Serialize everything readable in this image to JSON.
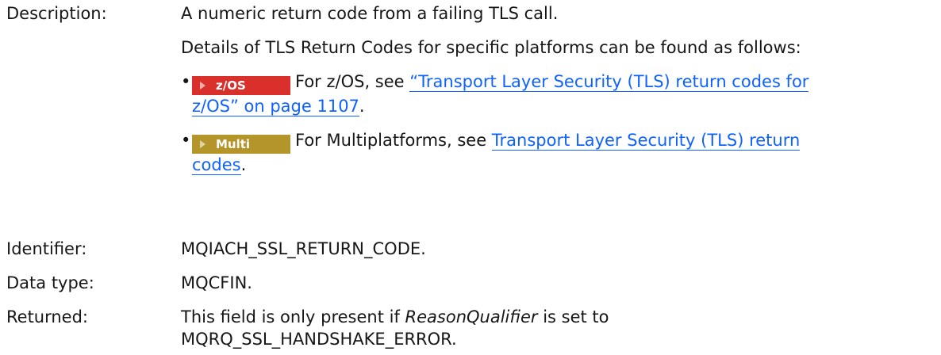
{
  "rows": {
    "description": {
      "label": "Description:",
      "line1": "A numeric return code from a failing TLS call.",
      "line2": "Details of TLS Return Codes for specific platforms can be found as follows:",
      "bullets": [
        {
          "badge_text": "z/OS",
          "badge_color": "#d9302c",
          "text_before": "For z/OS, see ",
          "link_line1": "“Transport Layer Security (TLS) return codes for",
          "link_line2": "z/OS” on page 1107",
          "text_after": "."
        },
        {
          "badge_text": "Multi",
          "badge_color": "#b3952a",
          "text_before": "For Multiplatforms, see ",
          "link_line1": "Transport Layer Security (TLS) return",
          "link_line2": "codes",
          "text_after": "."
        }
      ]
    },
    "identifier": {
      "label": "Identifier:",
      "value": "MQIACH_SSL_RETURN_CODE."
    },
    "data_type": {
      "label": "Data type:",
      "value": "MQCFIN."
    },
    "returned": {
      "label": "Returned:",
      "text_before": "This field is only present if ",
      "emphasis": "ReasonQualifier",
      "text_after": " is set to",
      "line2": "MQRQ_SSL_HANDSHAKE_ERROR."
    }
  },
  "colors": {
    "link": "#0f62fe",
    "text": "#161616"
  }
}
